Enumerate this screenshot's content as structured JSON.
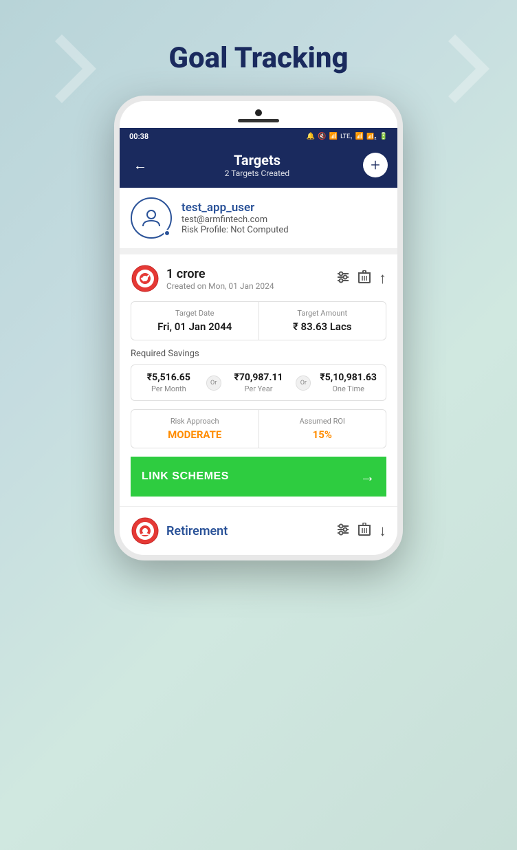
{
  "page": {
    "title": "Goal Tracking",
    "background_arrows": true
  },
  "status_bar": {
    "time": "00:38",
    "icons": "🔔 🔇 📶 LTE₁.ıl 📶₂.ıl 🔋"
  },
  "nav_bar": {
    "back_icon": "←",
    "title": "Targets",
    "subtitle": "2 Targets Created",
    "add_icon": "+"
  },
  "user": {
    "name": "test_app_user",
    "email": "test@armfintech.com",
    "risk_profile": "Risk Profile: Not Computed"
  },
  "target_1": {
    "name": "1 crore",
    "created": "Created on Mon, 01 Jan 2024",
    "target_date_label": "Target Date",
    "target_date_value": "Fri, 01 Jan 2044",
    "target_amount_label": "Target Amount",
    "target_amount_value": "₹ 83.63 Lacs",
    "required_savings_label": "Required Savings",
    "savings": [
      {
        "amount": "₹5,516.65",
        "period": "Per Month"
      },
      {
        "amount": "₹70,987.11",
        "period": "Per Year"
      },
      {
        "amount": "₹5,10,981.63",
        "period": "One Time"
      }
    ],
    "or_label": "Or",
    "risk_approach_label": "Risk Approach",
    "risk_approach_value": "MODERATE",
    "assumed_roi_label": "Assumed ROI",
    "assumed_roi_value": "15%",
    "link_schemes_label": "LINK SCHEMES",
    "link_schemes_arrow": "→"
  },
  "target_2": {
    "name": "Retirement",
    "icon_color": "#e53935"
  },
  "icons": {
    "back": "←",
    "add": "+",
    "settings": "⊞",
    "trash": "🗑",
    "up_arrow": "↑",
    "down_arrow": "↓",
    "right_arrow": "→"
  }
}
